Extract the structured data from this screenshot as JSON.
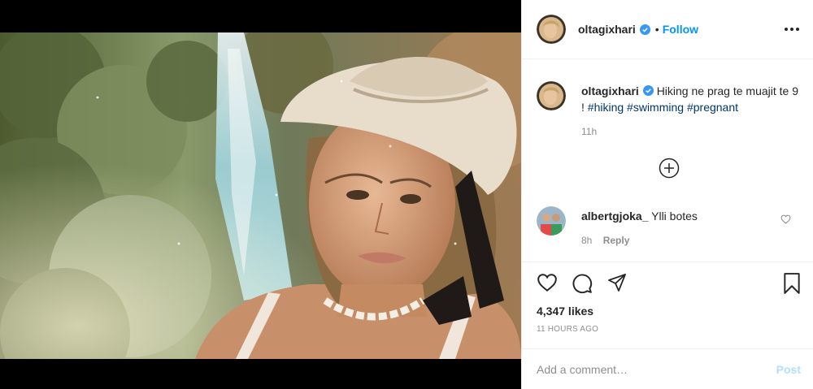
{
  "post": {
    "username": "oltagixhari",
    "follow_label": "Follow",
    "separator": "•",
    "caption": "Hiking ne prag te muajit te 9 !",
    "hashtags": [
      "#hiking",
      "#swimming",
      "#pregnant"
    ],
    "caption_time": "11h",
    "likes": "4,347 likes",
    "posted_ago": "11 HOURS AGO"
  },
  "comment": {
    "username": "albertgjoka_",
    "text": "Ylli botes",
    "time": "8h",
    "reply_label": "Reply"
  },
  "composer": {
    "placeholder": "Add a comment…",
    "post_label": "Post"
  },
  "colors": {
    "accent": "#0095f6",
    "verified": "#3897f0",
    "post_disabled": "#b2dffc",
    "tag": "#00376b"
  },
  "icons": {
    "verified": "verified-badge-icon",
    "more": "more-options-icon",
    "add": "plus-circle-icon",
    "like": "heart-icon",
    "comment": "comment-icon",
    "share": "share-icon",
    "save": "bookmark-icon"
  }
}
